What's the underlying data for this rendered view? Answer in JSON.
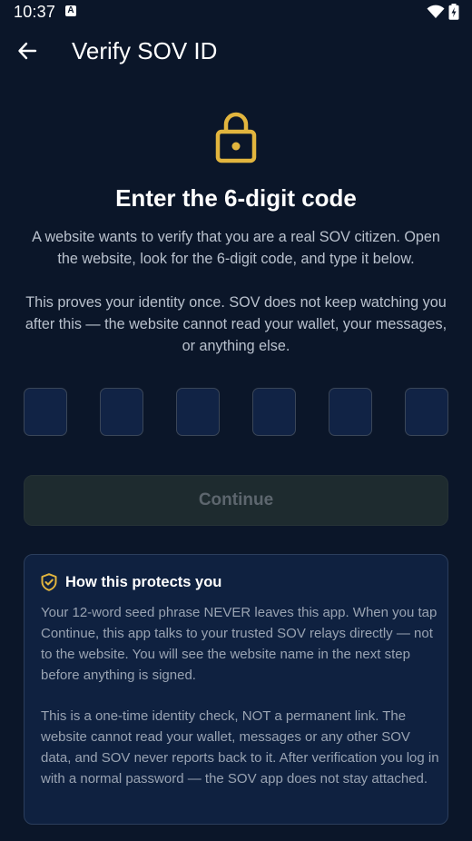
{
  "status_bar": {
    "time": "10:37",
    "notification_icon": "a-letter-icon",
    "wifi_icon": "wifi-icon",
    "battery_icon": "battery-charging-icon"
  },
  "app_bar": {
    "back_icon": "arrow-left-icon",
    "title": "Verify SOV ID"
  },
  "hero": {
    "icon": "lock-icon",
    "icon_color": "#e2b53e",
    "heading": "Enter the 6-digit code",
    "paragraph1": "A website wants to verify that you are a real SOV citizen. Open the website, look for the 6-digit code, and type it below.",
    "paragraph2": "This proves your identity once. SOV does not keep watching you after this — the website cannot read your wallet, your messages, or anything else."
  },
  "code_input": {
    "digits": [
      "",
      "",
      "",
      "",
      "",
      ""
    ]
  },
  "continue_button": {
    "label": "Continue",
    "enabled": false
  },
  "info_card": {
    "icon": "shield-check-icon",
    "icon_color": "#e2b53e",
    "title": "How this protects you",
    "paragraph1": "Your 12-word seed phrase NEVER leaves this app. When you tap Continue, this app talks to your trusted SOV relays directly — not to the website. You will see the website name in the next step before anything is signed.",
    "paragraph2": "This is a one-time identity check, NOT a permanent link. The website cannot read your wallet, messages or any other SOV data, and SOV never reports back to it. After verification you log in with a normal password — the SOV app does not stay attached."
  },
  "colors": {
    "background": "#0b1629",
    "accent": "#e2b53e",
    "card": "#0f2140",
    "code_box": "#112345"
  }
}
